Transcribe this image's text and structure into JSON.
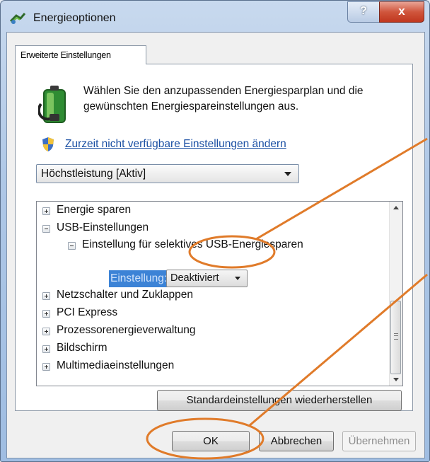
{
  "window": {
    "title": "Energieoptionen",
    "help_label": "?",
    "close_label": "x"
  },
  "tab": {
    "label": "Erweiterte Einstellungen"
  },
  "header": {
    "description": "Wählen Sie den anzupassenden Energiesparplan und die gewünschten Energiespareinstellungen aus.",
    "change_link": "Zurzeit nicht verfügbare Einstellungen ändern"
  },
  "plan_select": {
    "value": "Höchstleistung [Aktiv]"
  },
  "tree": {
    "items": [
      {
        "label": "Energie sparen",
        "state": "plus"
      },
      {
        "label": "USB-Einstellungen",
        "state": "minus"
      },
      {
        "label": "Einstellung für selektives USB-Energiesparen",
        "state": "minus"
      },
      {
        "label": "Netzschalter und Zuklappen",
        "state": "plus"
      },
      {
        "label": "PCI Express",
        "state": "plus"
      },
      {
        "label": "Prozessorenergieverwaltung",
        "state": "plus"
      },
      {
        "label": "Bildschirm",
        "state": "plus"
      },
      {
        "label": "Multimediaeinstellungen",
        "state": "plus"
      }
    ],
    "setting_label": "Einstellung:",
    "setting_value": "Deaktiviert"
  },
  "buttons": {
    "restore": "Standardeinstellungen wiederherstellen",
    "ok": "OK",
    "cancel": "Abbrechen",
    "apply": "Übernehmen"
  },
  "colors": {
    "annotation": "#e07b2a",
    "link": "#1a4fa3",
    "selection": "#3c83d6"
  }
}
